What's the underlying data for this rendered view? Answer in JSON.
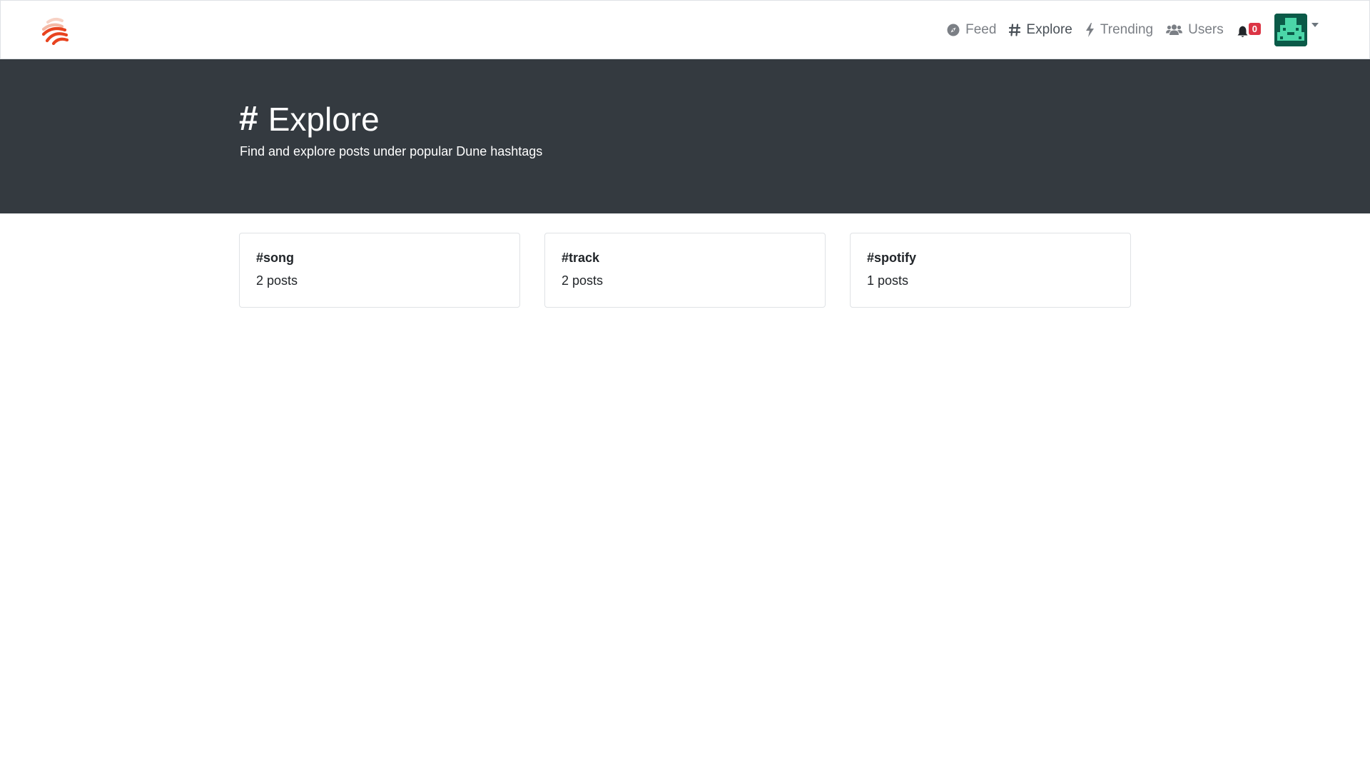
{
  "navbar": {
    "brand_color": "#e8431f",
    "links": [
      {
        "label": "Feed",
        "icon": "compass-icon",
        "active": false
      },
      {
        "label": "Explore",
        "icon": "hash-icon",
        "active": true
      },
      {
        "label": "Trending",
        "icon": "bolt-icon",
        "active": false
      },
      {
        "label": "Users",
        "icon": "users-icon",
        "active": false
      }
    ],
    "notifications_count": "0",
    "avatar_color": "#0b5a48",
    "avatar_pattern_color": "#4bd6a8"
  },
  "hero": {
    "title": "Explore",
    "hash": "#",
    "subtitle": "Find and explore posts under popular Dune hashtags",
    "background": "#343a40"
  },
  "hashtags": [
    {
      "tag": "#song",
      "count": "2 posts"
    },
    {
      "tag": "#track",
      "count": "2 posts"
    },
    {
      "tag": "#spotify",
      "count": "1 posts"
    }
  ]
}
